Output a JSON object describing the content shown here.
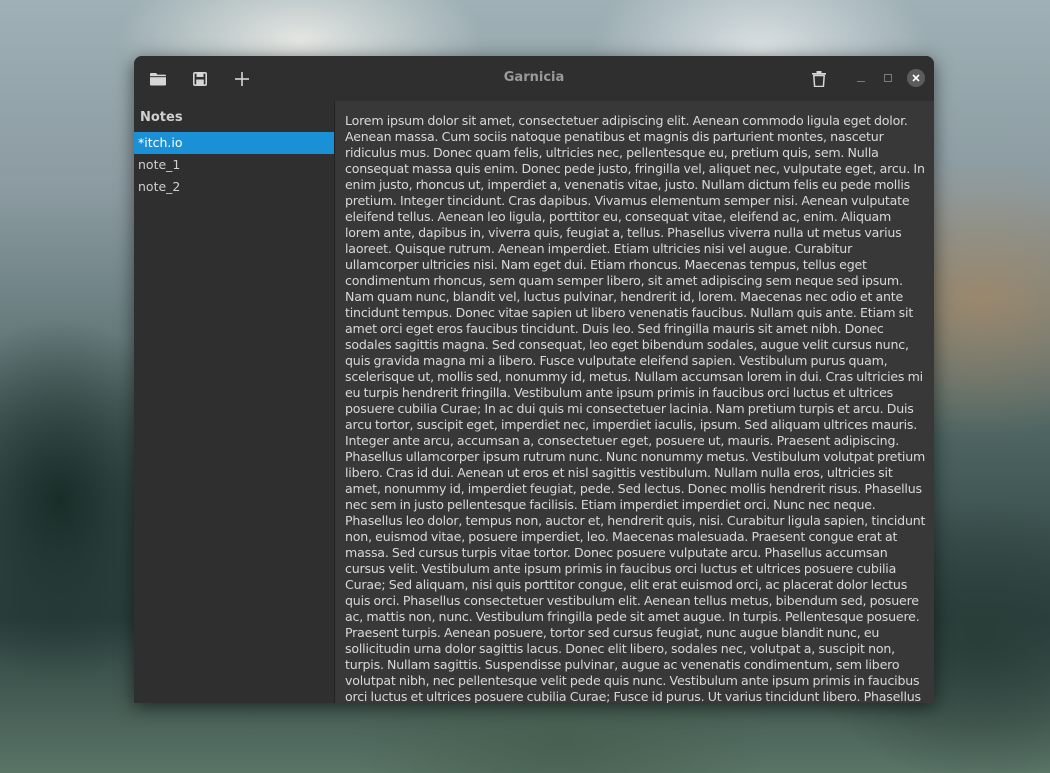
{
  "window": {
    "title": "Garnicia"
  },
  "toolbar": {
    "open_icon": "folder-icon",
    "save_icon": "save-icon",
    "add_icon": "plus-icon",
    "delete_icon": "trash-icon",
    "minimize_icon": "minimize-icon",
    "maximize_icon": "maximize-icon",
    "close_icon": "close-icon"
  },
  "sidebar": {
    "title": "Notes",
    "items": [
      {
        "label": "*itch.io",
        "selected": true
      },
      {
        "label": "note_1",
        "selected": false
      },
      {
        "label": "note_2",
        "selected": false
      }
    ]
  },
  "editor": {
    "text": "Lorem ipsum dolor sit amet, consectetuer adipiscing elit. Aenean commodo ligula eget dolor. Aenean massa. Cum sociis natoque penatibus et magnis dis parturient montes, nascetur ridiculus mus. Donec quam felis, ultricies nec, pellentesque eu, pretium quis, sem. Nulla consequat massa quis enim. Donec pede justo, fringilla vel, aliquet nec, vulputate eget, arcu. In enim justo, rhoncus ut, imperdiet a, venenatis vitae, justo. Nullam dictum felis eu pede mollis pretium. Integer tincidunt. Cras dapibus. Vivamus elementum semper nisi. Aenean vulputate eleifend tellus. Aenean leo ligula, porttitor eu, consequat vitae, eleifend ac, enim. Aliquam lorem ante, dapibus in, viverra quis, feugiat a, tellus. Phasellus viverra nulla ut metus varius laoreet. Quisque rutrum. Aenean imperdiet. Etiam ultricies nisi vel augue. Curabitur ullamcorper ultricies nisi. Nam eget dui. Etiam rhoncus. Maecenas tempus, tellus eget condimentum rhoncus, sem quam semper libero, sit amet adipiscing sem neque sed ipsum. Nam quam nunc, blandit vel, luctus pulvinar, hendrerit id, lorem. Maecenas nec odio et ante tincidunt tempus. Donec vitae sapien ut libero venenatis faucibus. Nullam quis ante. Etiam sit amet orci eget eros faucibus tincidunt. Duis leo. Sed fringilla mauris sit amet nibh. Donec sodales sagittis magna. Sed consequat, leo eget bibendum sodales, augue velit cursus nunc, quis gravida magna mi a libero. Fusce vulputate eleifend sapien. Vestibulum purus quam, scelerisque ut, mollis sed, nonummy id, metus. Nullam accumsan lorem in dui. Cras ultricies mi eu turpis hendrerit fringilla. Vestibulum ante ipsum primis in faucibus orci luctus et ultrices posuere cubilia Curae; In ac dui quis mi consectetuer lacinia. Nam pretium turpis et arcu. Duis arcu tortor, suscipit eget, imperdiet nec, imperdiet iaculis, ipsum. Sed aliquam ultrices mauris. Integer ante arcu, accumsan a, consectetuer eget, posuere ut, mauris. Praesent adipiscing. Phasellus ullamcorper ipsum rutrum nunc. Nunc nonummy metus. Vestibulum volutpat pretium libero. Cras id dui. Aenean ut eros et nisl sagittis vestibulum. Nullam nulla eros, ultricies sit amet, nonummy id, imperdiet feugiat, pede. Sed lectus. Donec mollis hendrerit risus. Phasellus nec sem in justo pellentesque facilisis. Etiam imperdiet imperdiet orci. Nunc nec neque. Phasellus leo dolor, tempus non, auctor et, hendrerit quis, nisi. Curabitur ligula sapien, tincidunt non, euismod vitae, posuere imperdiet, leo. Maecenas malesuada. Praesent congue erat at massa. Sed cursus turpis vitae tortor. Donec posuere vulputate arcu. Phasellus accumsan cursus velit. Vestibulum ante ipsum primis in faucibus orci luctus et ultrices posuere cubilia Curae; Sed aliquam, nisi quis porttitor congue, elit erat euismod orci, ac placerat dolor lectus quis orci. Phasellus consectetuer vestibulum elit. Aenean tellus metus, bibendum sed, posuere ac, mattis non, nunc. Vestibulum fringilla pede sit amet augue. In turpis. Pellentesque posuere. Praesent turpis. Aenean posuere, tortor sed cursus feugiat, nunc augue blandit nunc, eu sollicitudin urna dolor sagittis lacus. Donec elit libero, sodales nec, volutpat a, suscipit non, turpis. Nullam sagittis. Suspendisse pulvinar, augue ac venenatis condimentum, sem libero volutpat nibh, nec pellentesque velit pede quis nunc. Vestibulum ante ipsum primis in faucibus orci luctus et ultrices posuere cubilia Curae; Fusce id purus. Ut varius tincidunt libero. Phasellus dolor. Maecenas vestibulum mollis diam. Pellentesque ut neque."
  },
  "colors": {
    "selection": "#1a91d6",
    "headerbar": "#2f2f2f",
    "editor_bg": "#383838"
  }
}
